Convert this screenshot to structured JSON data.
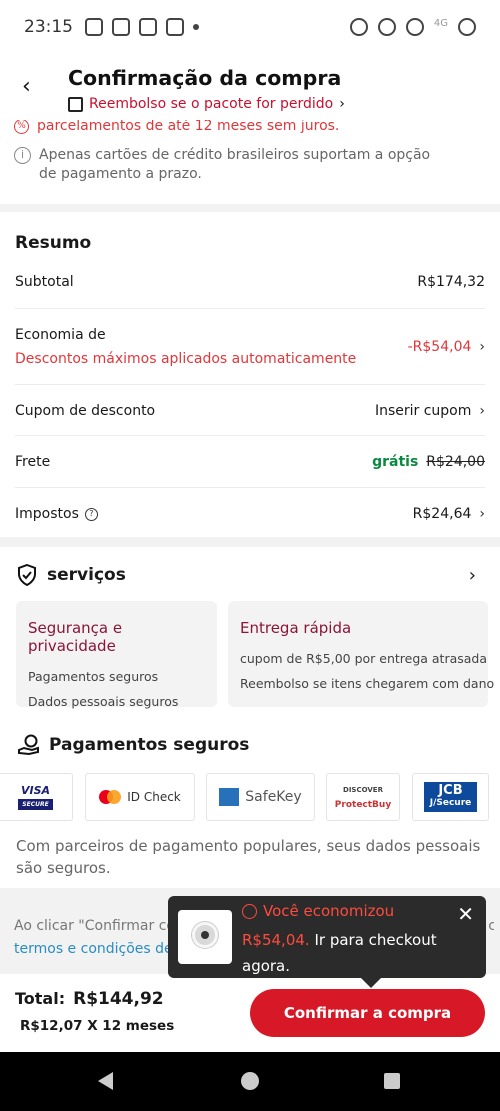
{
  "status_bar": {
    "time": "23:15",
    "network": "4G"
  },
  "header": {
    "title": "Confirmação da compra",
    "subtitle": "Reembolso se o pacote for perdido",
    "subtitle_chevron": "›"
  },
  "payment_info": {
    "promo_text": "parcelamentos de até 12 meses sem juros.",
    "info_text": "Apenas cartões de crédito brasileiros suportam a opção de pagamento a prazo."
  },
  "summary": {
    "title": "Resumo",
    "subtotal_label": "Subtotal",
    "subtotal_value": "R$174,32",
    "economy_label": "Economia de",
    "economy_note": "Descontos máximos aplicados automaticamente",
    "economy_value": "-R$54,04",
    "coupon_label": "Cupom de desconto",
    "coupon_value": "Inserir cupom",
    "shipping_label": "Frete",
    "shipping_free": "grátis",
    "shipping_original": "R$24,00",
    "taxes_label": "Impostos",
    "taxes_value": "R$24,64"
  },
  "services": {
    "title": "serviços",
    "cards": [
      {
        "title": "Segurança e privacidade",
        "lines": [
          "Pagamentos seguros",
          "Dados pessoais seguros"
        ]
      },
      {
        "title": "Entrega rápida",
        "lines": [
          "cupom de R$5,00 por entrega atrasada",
          "Reembolso se itens chegarem com dano"
        ]
      }
    ]
  },
  "secure_payments": {
    "title": "Pagamentos seguros",
    "badges": {
      "visa": "VISA",
      "visa_sub": "SECURE",
      "mastercard": "ID Check",
      "amex": "SafeKey",
      "discover": "DISCOVER",
      "discover_sub": "ProtectBuy",
      "jcb": "JCB",
      "jcb_sub": "J/Secure"
    },
    "note": "Com parceiros de pagamento populares, seus dados pessoais são seguros."
  },
  "terms": {
    "text": "Ao clicar \"Confirmar com",
    "text_end": "dido com os",
    "link": "termos e condições de"
  },
  "toast": {
    "headline": "Você economizou",
    "amount": "R$54,04.",
    "message": "Ir para checkout agora."
  },
  "bottom_bar": {
    "total_label": "Total:",
    "total_value": "R$144,92",
    "installments": "R$12,07 X 12 meses",
    "confirm_button": "Confirmar a compra"
  },
  "colors": {
    "accent": "#d71927",
    "discount": "#e0373b",
    "free_shipping": "#0a8a41"
  }
}
